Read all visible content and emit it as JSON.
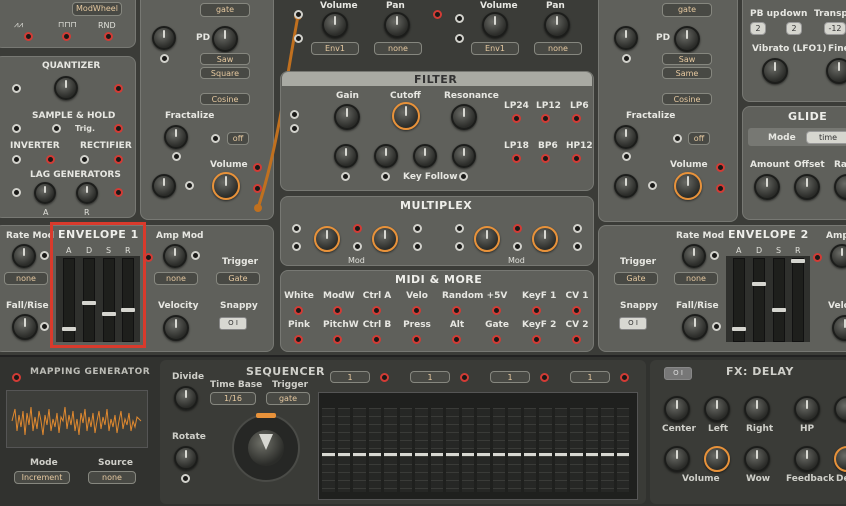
{
  "osc_left": {
    "modwheel_label": "ModWheel",
    "wave_rnd": "RND"
  },
  "osc_a": {
    "gate": "gate",
    "pd_label": "PD",
    "saw": "Saw",
    "square": "Square",
    "cosine": "Cosine",
    "fractalize_label": "Fractalize",
    "off": "off",
    "volume_label": "Volume"
  },
  "osc_b": {
    "gate": "gate",
    "pd_label": "PD",
    "saw": "Saw",
    "same": "Same",
    "cosine": "Cosine",
    "fractalize_label": "Fractalize",
    "off": "off",
    "volume_label": "Volume"
  },
  "mixer": {
    "volume1_label": "Volume",
    "pan1_label": "Pan",
    "env1": "Env1",
    "none1": "none",
    "volume2_label": "Volume",
    "pan2_label": "Pan",
    "env2": "Env1",
    "none2": "none"
  },
  "filter": {
    "title": "FILTER",
    "gain_label": "Gain",
    "cutoff_label": "Cutoff",
    "resonance_label": "Resonance",
    "key_follow_label": "Key Follow",
    "modes": [
      "LP24",
      "LP12",
      "LP6",
      "LP18",
      "BP6",
      "HP12"
    ]
  },
  "multiplex": {
    "title": "MULTIPLEX",
    "mod1": "Mod",
    "mod2": "Mod"
  },
  "midi": {
    "title": "MIDI & MORE",
    "row1": [
      "White",
      "ModW",
      "Ctrl A",
      "Velo",
      "Random",
      "+5V",
      "KeyF 1",
      "CV 1"
    ],
    "row2": [
      "Pink",
      "PitchW",
      "Ctrl B",
      "Press",
      "Alt",
      "Gate",
      "KeyF 2",
      "CV 2"
    ]
  },
  "utility": {
    "quantizer": "QUANTIZER",
    "sample_hold": "SAMPLE & HOLD",
    "trig": "Trig.",
    "inverter": "INVERTER",
    "rectifier": "RECTIFIER",
    "lag": "LAG GENERATORS",
    "lag_a": "A",
    "lag_r": "R"
  },
  "env1": {
    "rate_mod": "Rate Mod",
    "rate_none": "none",
    "fall_rise": "Fall/Rise",
    "title": "ENVELOPE 1",
    "adsr": [
      "A",
      "D",
      "S",
      "R"
    ],
    "amp_mod": "Amp Mod",
    "amp_none": "none",
    "trigger": "Trigger",
    "trigger_val": "Gate",
    "velocity": "Velocity",
    "snappy": "Snappy",
    "levels": [
      0.1,
      0.45,
      0.3,
      0.35
    ]
  },
  "env2": {
    "trigger": "Trigger",
    "trigger_val": "Gate",
    "rate_mod": "Rate Mod",
    "rate_none": "none",
    "title": "ENVELOPE 2",
    "adsr": [
      "A",
      "D",
      "S",
      "R"
    ],
    "amp": "Amp",
    "snappy": "Snappy",
    "fall_rise": "Fall/Rise",
    "velo": "Velo",
    "levels": [
      0.1,
      0.7,
      0.35,
      1.0
    ]
  },
  "pitch": {
    "pb_up": "PB up",
    "down": "down",
    "transpose": "Transpo",
    "pb_up_val": "2",
    "down_val": "2",
    "transpose_val": "-12",
    "vibrato": "Vibrato (LFO1)",
    "fine": "Fine"
  },
  "glide": {
    "title": "GLIDE",
    "mode": "Mode",
    "mode_val": "time",
    "amount": "Amount",
    "offset": "Offset",
    "rate": "Ra"
  },
  "mapping": {
    "title": "MAPPING GENERATOR",
    "mode": "Mode",
    "mode_val": "Increment",
    "source": "Source",
    "source_val": "none"
  },
  "sequencer": {
    "title": "SEQUENCER",
    "divide": "Divide",
    "time_base": "Time Base",
    "time_base_val": "1/16",
    "trigger": "Trigger",
    "trigger_val": "gate",
    "rotate": "Rotate",
    "lane_vals": [
      "1",
      "1",
      "1",
      "1"
    ],
    "steps": [
      0.45,
      0.45,
      0.45,
      0.45,
      0.45,
      0.45,
      0.45,
      0.45,
      0.45,
      0.45,
      0.45,
      0.45,
      0.45,
      0.45,
      0.45,
      0.45,
      0.45,
      0.45,
      0.45,
      0.45
    ]
  },
  "fx": {
    "title": "FX: DELAY",
    "center": "Center",
    "left": "Left",
    "right": "Right",
    "hp": "HP",
    "volume": "Volume",
    "wow": "Wow",
    "feedback": "Feedback",
    "de": "De"
  }
}
